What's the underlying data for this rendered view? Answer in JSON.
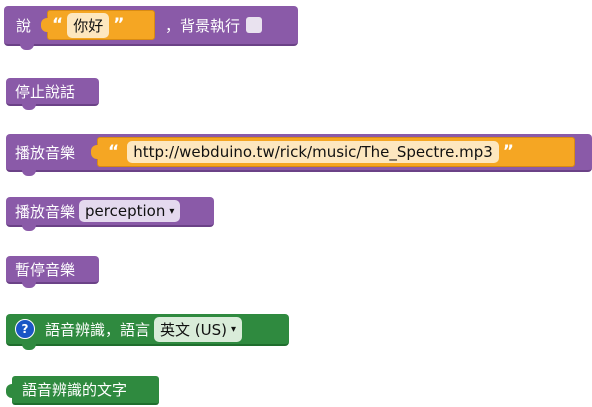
{
  "blocks": {
    "say": {
      "label": "說",
      "text_value": "你好",
      "open_quote": "“",
      "close_quote": "”",
      "background_label": "，背景執行"
    },
    "stop_speaking": {
      "label": "停止說話"
    },
    "play_music_url": {
      "label": "播放音樂",
      "url": "http://webduino.tw/rick/music/The_Spectre.mp3",
      "open_quote": "“",
      "close_quote": "”"
    },
    "play_music_select": {
      "label": "播放音樂",
      "selected": "perception",
      "caret": "▾"
    },
    "pause_music": {
      "label": "暫停音樂"
    },
    "speech_recognition": {
      "help": "?",
      "label": "語音辨識，語言",
      "language": "英文 (US)",
      "caret": "▾"
    },
    "recognized_text": {
      "label": "語音辨識的文字"
    }
  },
  "colors": {
    "purple": "#8a5aa8",
    "orange": "#f5a623",
    "green": "#2f8a3f",
    "help_blue": "#1a56c5"
  }
}
